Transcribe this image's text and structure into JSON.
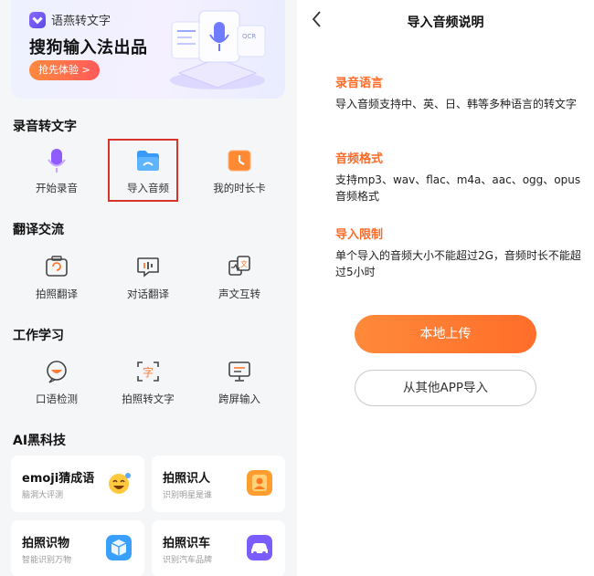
{
  "banner": {
    "brand": "语燕转文字",
    "title": "搜狗输入法出品",
    "cta": "抢先体验 >"
  },
  "sections": {
    "record": {
      "title": "录音转文字",
      "items": [
        "开始录音",
        "导入音频",
        "我的时长卡"
      ]
    },
    "translate": {
      "title": "翻译交流",
      "items": [
        "拍照翻译",
        "对话翻译",
        "声文互转"
      ]
    },
    "study": {
      "title": "工作学习",
      "items": [
        "口语检测",
        "拍照转文字",
        "跨屏输入"
      ]
    },
    "ai": {
      "title": "AI黑科技",
      "cards": [
        {
          "title": "emoji猜成语",
          "sub": "脑洞大评测"
        },
        {
          "title": "拍照识人",
          "sub": "识别明星是谁"
        },
        {
          "title": "拍照识物",
          "sub": "智能识别万物"
        },
        {
          "title": "拍照识车",
          "sub": "识别汽车品牌"
        }
      ]
    }
  },
  "detail": {
    "nav_title": "导入音频说明",
    "blocks": [
      {
        "heading": "录音语言",
        "body": "导入音频支持中、英、日、韩等多种语言的转文字"
      },
      {
        "heading": "音频格式",
        "body": "支持mp3、wav、flac、m4a、aac、ogg、opus音频格式"
      },
      {
        "heading": "导入限制",
        "body": "单个导入的音频大小不能超过2G，音频时长不能超过5小时"
      }
    ],
    "primary_button": "本地上传",
    "secondary_button": "从其他APP导入"
  },
  "colors": {
    "accent_orange": "#ff6a26",
    "highlight_red": "#d9342b",
    "brand_purple": "#6b55f0"
  }
}
